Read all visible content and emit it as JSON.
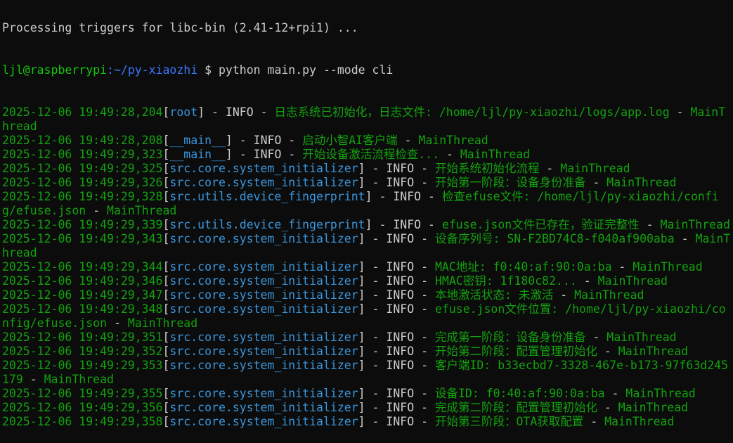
{
  "terminal": {
    "top_partial": "Processing triggers for libc-bin (2.41-12+rpi1) ...",
    "prompt": {
      "user_host": "ljl@raspberrypi",
      "path": ":~/py-xiaozhi",
      "symbol": " $ ",
      "command": "python main.py --mode cli"
    },
    "lines": [
      {
        "ts": "2025-12-06 19:49:28,204",
        "mod": "root",
        "level": "INFO",
        "msg": "日志系统已初始化，日志文件: /home/ljl/py-xiaozhi/logs/app.log",
        "thread": "MainThread"
      },
      {
        "ts": "2025-12-06 19:49:28,208",
        "mod": "__main__",
        "level": "INFO",
        "msg": "启动小智AI客户端",
        "thread": "MainThread"
      },
      {
        "ts": "2025-12-06 19:49:29,323",
        "mod": "__main__",
        "level": "INFO",
        "msg": "开始设备激活流程检查...",
        "thread": "MainThread"
      },
      {
        "ts": "2025-12-06 19:49:29,325",
        "mod": "src.core.system_initializer",
        "level": "INFO",
        "msg": "开始系统初始化流程",
        "thread": "MainThread"
      },
      {
        "ts": "2025-12-06 19:49:29,326",
        "mod": "src.core.system_initializer",
        "level": "INFO",
        "msg": "开始第一阶段：设备身份准备",
        "thread": "MainThread"
      },
      {
        "ts": "2025-12-06 19:49:29,328",
        "mod": "src.utils.device_fingerprint",
        "level": "INFO",
        "msg": "检查efuse文件: /home/ljl/py-xiaozhi/config/efuse.json",
        "thread": "MainThread"
      },
      {
        "ts": "2025-12-06 19:49:29,339",
        "mod": "src.utils.device_fingerprint",
        "level": "INFO",
        "msg": "efuse.json文件已存在，验证完整性",
        "thread": "MainThread"
      },
      {
        "ts": "2025-12-06 19:49:29,343",
        "mod": "src.core.system_initializer",
        "level": "INFO",
        "msg": "设备序列号: SN-F2BD74C8-f040af900aba",
        "thread": "MainThread"
      },
      {
        "ts": "2025-12-06 19:49:29,344",
        "mod": "src.core.system_initializer",
        "level": "INFO",
        "msg": "MAC地址: f0:40:af:90:0a:ba",
        "thread": "MainThread"
      },
      {
        "ts": "2025-12-06 19:49:29,346",
        "mod": "src.core.system_initializer",
        "level": "INFO",
        "msg": "HMAC密钥: 1f180c82...",
        "thread": "MainThread"
      },
      {
        "ts": "2025-12-06 19:49:29,347",
        "mod": "src.core.system_initializer",
        "level": "INFO",
        "msg": "本地激活状态: 未激活",
        "thread": "MainThread"
      },
      {
        "ts": "2025-12-06 19:49:29,348",
        "mod": "src.core.system_initializer",
        "level": "INFO",
        "msg": "efuse.json文件位置: /home/ljl/py-xiaozhi/config/efuse.json",
        "thread": "MainThread"
      },
      {
        "ts": "2025-12-06 19:49:29,351",
        "mod": "src.core.system_initializer",
        "level": "INFO",
        "msg": "完成第一阶段：设备身份准备",
        "thread": "MainThread"
      },
      {
        "ts": "2025-12-06 19:49:29,352",
        "mod": "src.core.system_initializer",
        "level": "INFO",
        "msg": "开始第二阶段：配置管理初始化",
        "thread": "MainThread"
      },
      {
        "ts": "2025-12-06 19:49:29,353",
        "mod": "src.core.system_initializer",
        "level": "INFO",
        "msg": "客户端ID: b33ecbd7-3328-467e-b173-97f63d245179",
        "thread": "MainThread"
      },
      {
        "ts": "2025-12-06 19:49:29,355",
        "mod": "src.core.system_initializer",
        "level": "INFO",
        "msg": "设备ID: f0:40:af:90:0a:ba",
        "thread": "MainThread"
      },
      {
        "ts": "2025-12-06 19:49:29,356",
        "mod": "src.core.system_initializer",
        "level": "INFO",
        "msg": "完成第二阶段：配置管理初始化",
        "thread": "MainThread"
      },
      {
        "ts": "2025-12-06 19:49:29,358",
        "mod": "src.core.system_initializer",
        "level": "INFO",
        "msg": "开始第三阶段：OTA获取配置",
        "thread": "MainThread"
      }
    ]
  }
}
